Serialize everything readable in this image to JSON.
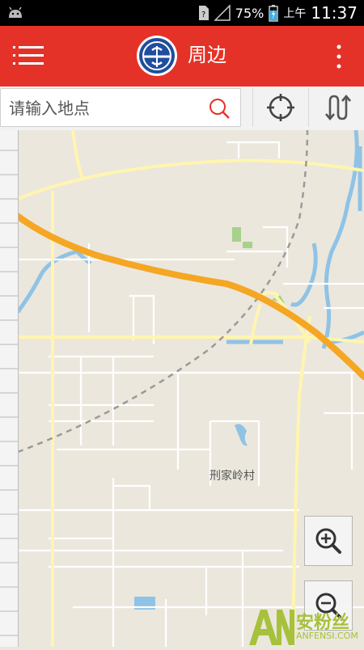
{
  "status_bar": {
    "battery": "75%",
    "ampm": "上午",
    "time": "11:37"
  },
  "app_bar": {
    "title": "周边",
    "menu_icon": "hamburger-menu-icon",
    "more_icon": "overflow-menu-icon",
    "brand_color": "#e53228"
  },
  "search": {
    "placeholder": "请输入地点",
    "search_icon": "search-icon",
    "locate_icon": "crosshair-locate-icon",
    "route_icon": "route-swap-icon"
  },
  "map": {
    "place_label": "刑家岭村",
    "zoom_in_icon": "zoom-in-icon",
    "zoom_out_icon": "zoom-out-icon",
    "road_color": "#fff5b0",
    "highway_color": "#f5a623",
    "water_color": "#8fc3e6",
    "background_color": "#ebe7dd"
  },
  "watermark": {
    "main": "安粉丝",
    "sub": "ANFENSI.COM"
  }
}
